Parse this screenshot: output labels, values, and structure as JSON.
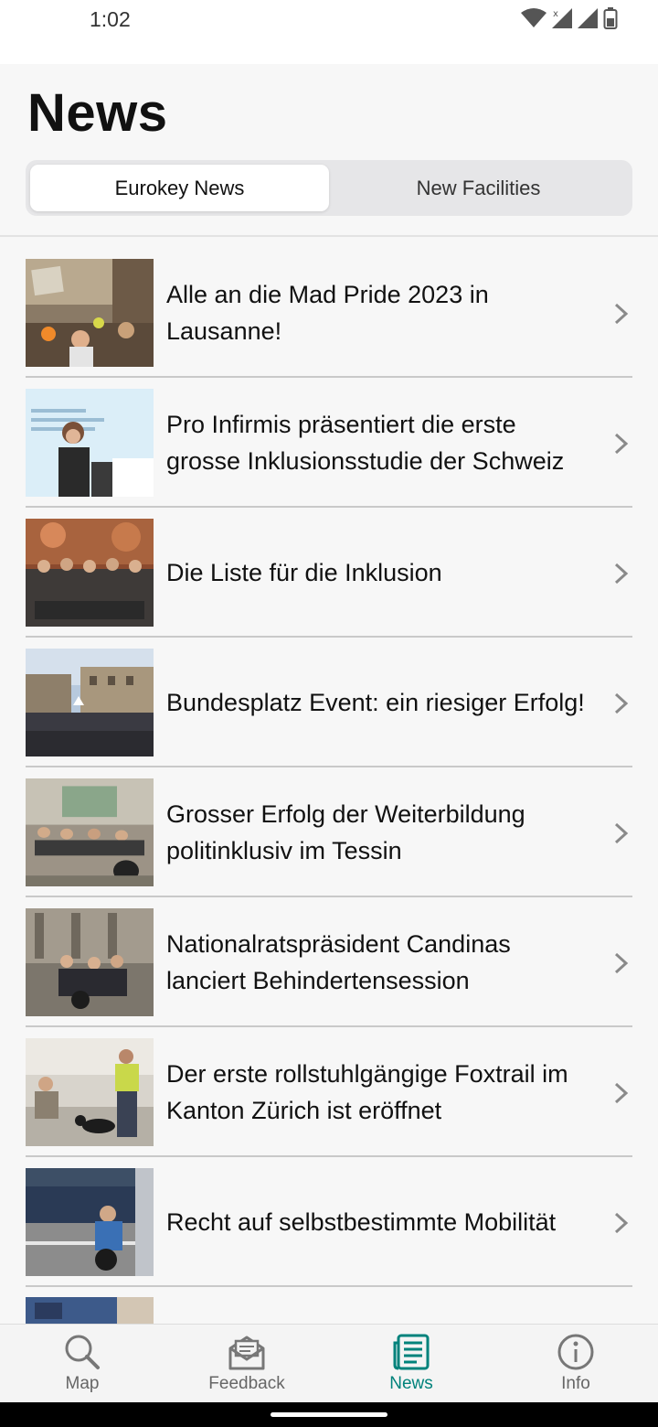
{
  "status_bar": {
    "time": "1:02",
    "icons": [
      "wifi-icon",
      "signal-icon",
      "signal-icon",
      "battery-icon"
    ]
  },
  "header": {
    "title": "News"
  },
  "tabs": [
    {
      "label": "Eurokey News",
      "active": true
    },
    {
      "label": "New Facilities",
      "active": false
    }
  ],
  "news": [
    {
      "title": "Alle an die Mad Pride 2023 in Lausanne!"
    },
    {
      "title": "Pro Infirmis präsentiert die erste grosse Inklusionsstudie der Schweiz"
    },
    {
      "title": "Die Liste für die Inklusion"
    },
    {
      "title": "Bundesplatz Event: ein riesiger Erfolg!"
    },
    {
      "title": "Grosser Erfolg der Weiterbildung politinklusiv im Tessin"
    },
    {
      "title": "Nationalratspräsident Candinas lanciert Behindertensession"
    },
    {
      "title": "Der erste rollstuhlgängige Foxtrail im Kanton Zürich ist eröffnet"
    },
    {
      "title": "Recht auf selbstbestimmte Mobilität"
    }
  ],
  "bottom_nav": [
    {
      "label": "Map",
      "icon": "search-icon",
      "active": false
    },
    {
      "label": "Feedback",
      "icon": "feedback-envelope-icon",
      "active": false
    },
    {
      "label": "News",
      "icon": "news-icon",
      "active": true
    },
    {
      "label": "Info",
      "icon": "info-icon",
      "active": false
    }
  ],
  "colors": {
    "accent": "#00827b",
    "background": "#f7f7f7",
    "inactive_nav": "#666666"
  }
}
